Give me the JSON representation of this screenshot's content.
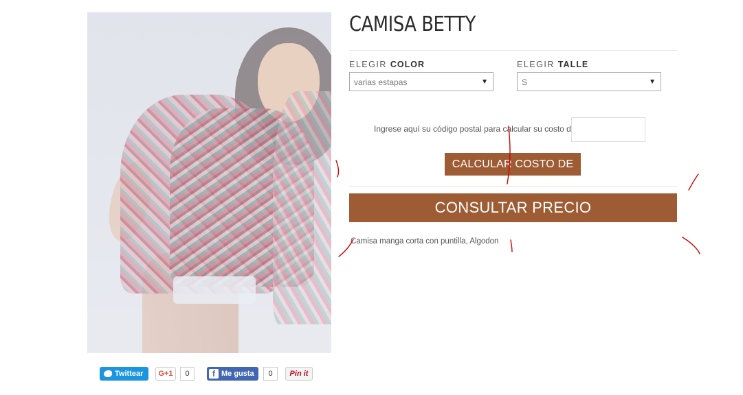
{
  "product": {
    "title": "CAMISA BETTY",
    "description": "Camisa manga corta con puntilla, Algodon"
  },
  "options": {
    "color": {
      "label_prefix": "ELEGIR",
      "label_strong": "COLOR",
      "selected": "varias estapas"
    },
    "talle": {
      "label_prefix": "ELEGIR",
      "label_strong": "TALLE",
      "selected": "S"
    }
  },
  "shipping": {
    "postal_label": "Ingrese aquí su código postal para calcular su costo de envío:",
    "postal_value": "",
    "calc_button": "CALCULAR COSTO DE ENVÍO"
  },
  "cta": {
    "price_button": "CONSULTAR PRECIO"
  },
  "share": {
    "twitter_label": "Twittear",
    "gplus_label": "G+1",
    "gplus_count": "0",
    "facebook_label": "Me gusta",
    "facebook_count": "0",
    "pinterest_label": "Pin it"
  },
  "colors": {
    "accent": "#9d5c34",
    "twitter": "#1b95e0",
    "facebook": "#4267b2",
    "annotation": "#d00000"
  }
}
